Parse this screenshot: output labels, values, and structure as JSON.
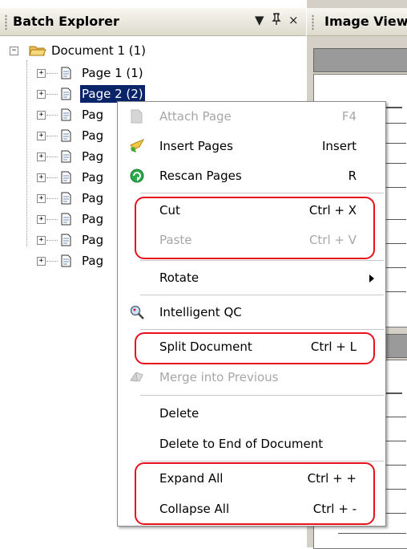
{
  "explorer": {
    "title": "Batch Explorer",
    "pin_glyph": "↓",
    "close_glyph": "×",
    "document_label": "Document 1 (1)",
    "pages": [
      {
        "label": "Page 1 (1)",
        "selected": false
      },
      {
        "label": "Page 2 (2)",
        "selected": true
      },
      {
        "label": "Pag",
        "selected": false
      },
      {
        "label": "Pag",
        "selected": false
      },
      {
        "label": "Pag",
        "selected": false
      },
      {
        "label": "Pag",
        "selected": false
      },
      {
        "label": "Pag",
        "selected": false
      },
      {
        "label": "Pag",
        "selected": false
      },
      {
        "label": "Pag",
        "selected": false
      },
      {
        "label": "Pag",
        "selected": false
      }
    ]
  },
  "viewer": {
    "title": "Image Viewer"
  },
  "menu": {
    "items": [
      {
        "label": "Attach Page",
        "shortcut": "F4",
        "icon": "attach-page-icon",
        "disabled": true
      },
      {
        "label": "Insert Pages",
        "shortcut": "Insert",
        "icon": "insert-pages-icon",
        "disabled": false
      },
      {
        "label": "Rescan Pages",
        "shortcut": "R",
        "icon": "rescan-icon",
        "disabled": false
      },
      {
        "label": "Cut",
        "shortcut": "Ctrl + X",
        "icon": "",
        "disabled": false
      },
      {
        "label": "Paste",
        "shortcut": "Ctrl + V",
        "icon": "",
        "disabled": true
      },
      {
        "label": "Rotate",
        "shortcut": "",
        "icon": "",
        "disabled": false,
        "submenu": true
      },
      {
        "label": "Intelligent QC",
        "shortcut": "",
        "icon": "magnifier-icon",
        "disabled": false
      },
      {
        "label": "Split Document",
        "shortcut": "Ctrl + L",
        "icon": "",
        "disabled": false
      },
      {
        "label": "Merge into Previous",
        "shortcut": "",
        "icon": "merge-icon",
        "disabled": true
      },
      {
        "label": "Delete",
        "shortcut": "",
        "icon": "",
        "disabled": false
      },
      {
        "label": "Delete to End of Document",
        "shortcut": "",
        "icon": "",
        "disabled": false
      },
      {
        "label": "Expand All",
        "shortcut": "Ctrl + +",
        "icon": "",
        "disabled": false
      },
      {
        "label": "Collapse All",
        "shortcut": "Ctrl + -",
        "icon": "",
        "disabled": false
      }
    ]
  },
  "colors": {
    "highlight": "#e8101a",
    "selection": "#0a246a",
    "folder": "#f0b030"
  }
}
